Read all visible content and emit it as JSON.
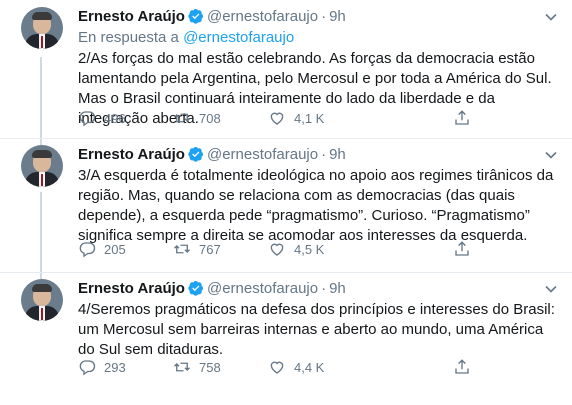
{
  "colors": {
    "accent": "#1da1f2",
    "text": "#14171a",
    "secondary": "#657786",
    "divider": "#e6ecf0"
  },
  "tweets": [
    {
      "name": "Ernesto Araújo",
      "handle": "@ernestofaraujo",
      "separator": "·",
      "time": "9h",
      "reply_prefix": "En respuesta a",
      "reply_handle": "@ernestofaraujo",
      "text": "2/As forças do mal estão celebrando. As forças da democracia estão lamentando pela Argentina, pelo Mercosul e por toda a América do Sul. Mas o Brasil continuará inteiramente do lado da liberdade e da integração aberta.",
      "replies": "496",
      "retweets": "708",
      "likes": "4,1 K",
      "icons": [
        "verified-badge-icon",
        "reply-icon",
        "retweet-icon",
        "like-icon",
        "share-icon",
        "chevron-down-icon"
      ]
    },
    {
      "name": "Ernesto Araújo",
      "handle": "@ernestofaraujo",
      "separator": "·",
      "time": "9h",
      "text": "3/A esquerda é totalmente ideológica no apoio aos regimes tirânicos da região. Mas, quando se relaciona com as democracias (das quais depende), a esquerda pede “pragmatismo”. Curioso. “Pragmatismo” significa sempre a direita se acomodar aos interesses da esquerda.",
      "replies": "205",
      "retweets": "767",
      "likes": "4,5 K"
    },
    {
      "name": "Ernesto Araújo",
      "handle": "@ernestofaraujo",
      "separator": "·",
      "time": "9h",
      "text": "4/Seremos pragmáticos na defesa dos princípios e interesses do Brasil: um Mercosul sem barreiras internas e aberto ao mundo, uma América do Sul sem ditaduras.",
      "replies": "293",
      "retweets": "758",
      "likes": "4,4 K"
    }
  ]
}
